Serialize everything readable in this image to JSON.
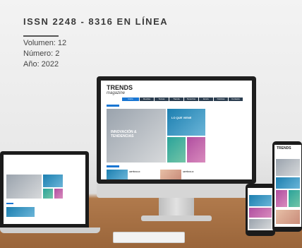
{
  "header": {
    "issn": "ISSN 2248 - 8316 EN LÍNEA",
    "volumen": "Volumen: 12",
    "numero": "Número: 2",
    "anio": "Año: 2022"
  },
  "site": {
    "logo_main": "TRENDS",
    "logo_sub": "magazine",
    "nav": [
      "Inicio",
      "Revista",
      "Temas",
      "Tienda",
      "Nosotros",
      "Envío",
      "Noticias",
      "Contacto"
    ],
    "featured_main": "INNOVACIÓN & TENDENCIAS",
    "featured_side": "LO QUE VIENE",
    "section_label": "Destacados",
    "card1": "ARTÍCULO",
    "card2": "ARTÍCULO"
  }
}
